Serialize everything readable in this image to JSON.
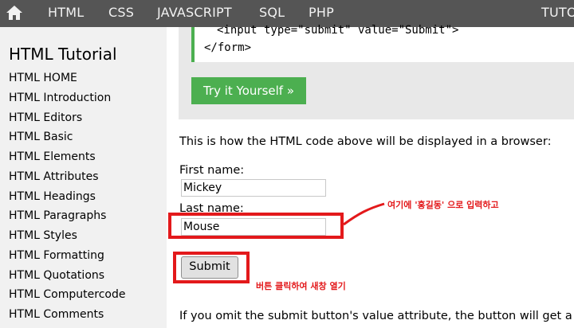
{
  "nav": {
    "items": [
      "HTML",
      "CSS",
      "JAVASCRIPT",
      "SQL",
      "PHP",
      "TUTO"
    ]
  },
  "sidebar": {
    "title": "HTML Tutorial",
    "items": [
      "HTML HOME",
      "HTML Introduction",
      "HTML Editors",
      "HTML Basic",
      "HTML Elements",
      "HTML Attributes",
      "HTML Headings",
      "HTML Paragraphs",
      "HTML Styles",
      "HTML Formatting",
      "HTML Quotations",
      "HTML Computercode",
      "HTML Comments"
    ]
  },
  "example": {
    "code_lines": [
      "<input type=\"submit\" value=\"Submit\">",
      "</form>"
    ],
    "try_button": "Try it Yourself »"
  },
  "main": {
    "intro_text": "This is how the HTML code above will be displayed in a browser:",
    "first_name_label": "First name:",
    "first_name_value": "Mickey",
    "last_name_label": "Last name:",
    "last_name_value": "Mouse",
    "submit_label": "Submit",
    "bottom_text": "If you omit the submit button's value attribute, the button will get a d"
  },
  "annotations": {
    "note_input": "여기에 '홍길동' 으로 입력하고",
    "note_button": "버튼 클릭하여 새창 열기"
  },
  "colors": {
    "nav_bg": "#555555",
    "sidebar_bg": "#f1f1f1",
    "accent_green": "#4caf50",
    "annotation_red": "#e3191b"
  }
}
